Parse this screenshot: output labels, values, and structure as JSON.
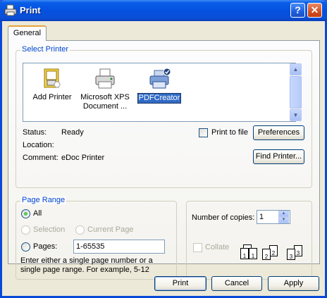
{
  "window": {
    "title": "Print",
    "help_glyph": "?",
    "close_glyph": "✕"
  },
  "tabs": [
    {
      "label": "General",
      "selected": true
    }
  ],
  "select_printer": {
    "group_title": "Select Printer",
    "printers": [
      {
        "label": "Add Printer",
        "icon": "add-printer-icon",
        "selected": false
      },
      {
        "label_line1": "Microsoft XPS",
        "label_line2": "Document ...",
        "icon": "printer-icon",
        "selected": false
      },
      {
        "label": "PDFCreator",
        "icon": "default-printer-icon",
        "selected": true
      }
    ],
    "status_label": "Status:",
    "status_value": "Ready",
    "location_label": "Location:",
    "location_value": "",
    "comment_label": "Comment:",
    "comment_value": "eDoc Printer",
    "print_to_file_label": "Print to file",
    "print_to_file_checked": false,
    "preferences_label": "Preferences",
    "find_printer_label": "Find Printer..."
  },
  "page_range": {
    "group_title": "Page Range",
    "all_label": "All",
    "all_selected": true,
    "selection_label": "Selection",
    "current_page_label": "Current Page",
    "pages_label": "Pages:",
    "pages_value": "1-65535",
    "hint": "Enter either a single page number or a single page range.  For example, 5-12"
  },
  "copies": {
    "number_label": "Number of copies:",
    "number_value": "1",
    "collate_label": "Collate",
    "collate_checked": false,
    "collate_pages": [
      "1",
      "1",
      "2",
      "2",
      "3",
      "3"
    ]
  },
  "footer": {
    "print_label": "Print",
    "cancel_label": "Cancel",
    "apply_label": "Apply"
  },
  "colors": {
    "titlebar": "#0451e0",
    "dialog_bg": "#ece9d8",
    "group_title": "#0046d5",
    "selection": "#316ac5"
  }
}
